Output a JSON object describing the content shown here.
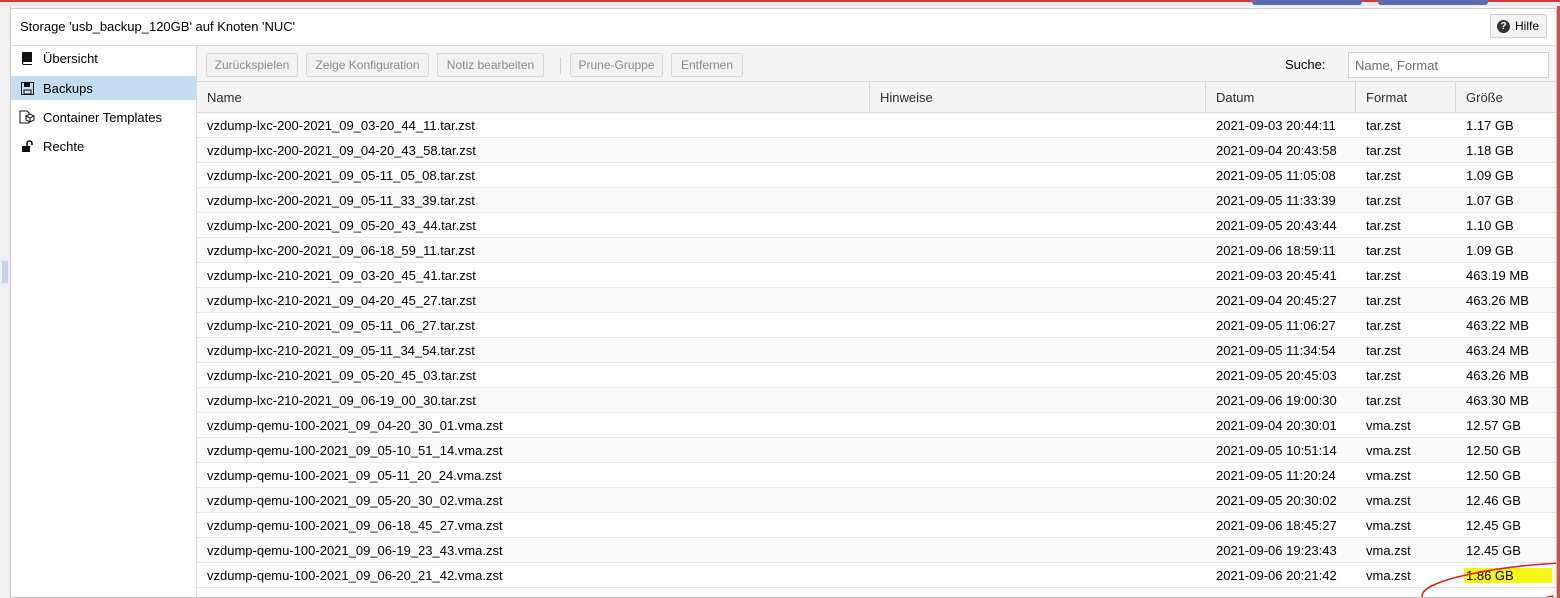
{
  "window": {
    "title": "Storage 'usb_backup_120GB' auf Knoten 'NUC'",
    "help_label": "Hilfe"
  },
  "sidebar": {
    "items": [
      {
        "label": "Übersicht",
        "icon": "book-icon"
      },
      {
        "label": "Backups",
        "icon": "floppy-disk-icon"
      },
      {
        "label": "Container Templates",
        "icon": "container-template-icon"
      },
      {
        "label": "Rechte",
        "icon": "unlock-icon"
      }
    ],
    "active": "Backups"
  },
  "toolbar": {
    "restore_label": "Zurückspielen",
    "show_config_label": "Zeige Konfiguration",
    "edit_notes_label": "Notiz bearbeiten",
    "prune_group_label": "Prune-Gruppe",
    "remove_label": "Entfernen",
    "search_label": "Suche:",
    "search_placeholder": "Name, Format"
  },
  "table": {
    "headers": {
      "name": "Name",
      "notes": "Hinweise",
      "date": "Datum",
      "format": "Format",
      "size": "Größe"
    },
    "rows": [
      {
        "name": "vzdump-lxc-200-2021_09_03-20_44_11.tar.zst",
        "notes": "",
        "date": "2021-09-03 20:44:11",
        "format": "tar.zst",
        "size": "1.17 GB"
      },
      {
        "name": "vzdump-lxc-200-2021_09_04-20_43_58.tar.zst",
        "notes": "",
        "date": "2021-09-04 20:43:58",
        "format": "tar.zst",
        "size": "1.18 GB"
      },
      {
        "name": "vzdump-lxc-200-2021_09_05-11_05_08.tar.zst",
        "notes": "",
        "date": "2021-09-05 11:05:08",
        "format": "tar.zst",
        "size": "1.09 GB"
      },
      {
        "name": "vzdump-lxc-200-2021_09_05-11_33_39.tar.zst",
        "notes": "",
        "date": "2021-09-05 11:33:39",
        "format": "tar.zst",
        "size": "1.07 GB"
      },
      {
        "name": "vzdump-lxc-200-2021_09_05-20_43_44.tar.zst",
        "notes": "",
        "date": "2021-09-05 20:43:44",
        "format": "tar.zst",
        "size": "1.10 GB"
      },
      {
        "name": "vzdump-lxc-200-2021_09_06-18_59_11.tar.zst",
        "notes": "",
        "date": "2021-09-06 18:59:11",
        "format": "tar.zst",
        "size": "1.09 GB"
      },
      {
        "name": "vzdump-lxc-210-2021_09_03-20_45_41.tar.zst",
        "notes": "",
        "date": "2021-09-03 20:45:41",
        "format": "tar.zst",
        "size": "463.19 MB"
      },
      {
        "name": "vzdump-lxc-210-2021_09_04-20_45_27.tar.zst",
        "notes": "",
        "date": "2021-09-04 20:45:27",
        "format": "tar.zst",
        "size": "463.26 MB"
      },
      {
        "name": "vzdump-lxc-210-2021_09_05-11_06_27.tar.zst",
        "notes": "",
        "date": "2021-09-05 11:06:27",
        "format": "tar.zst",
        "size": "463.22 MB"
      },
      {
        "name": "vzdump-lxc-210-2021_09_05-11_34_54.tar.zst",
        "notes": "",
        "date": "2021-09-05 11:34:54",
        "format": "tar.zst",
        "size": "463.24 MB"
      },
      {
        "name": "vzdump-lxc-210-2021_09_05-20_45_03.tar.zst",
        "notes": "",
        "date": "2021-09-05 20:45:03",
        "format": "tar.zst",
        "size": "463.26 MB"
      },
      {
        "name": "vzdump-lxc-210-2021_09_06-19_00_30.tar.zst",
        "notes": "",
        "date": "2021-09-06 19:00:30",
        "format": "tar.zst",
        "size": "463.30 MB"
      },
      {
        "name": "vzdump-qemu-100-2021_09_04-20_30_01.vma.zst",
        "notes": "",
        "date": "2021-09-04 20:30:01",
        "format": "vma.zst",
        "size": "12.57 GB"
      },
      {
        "name": "vzdump-qemu-100-2021_09_05-10_51_14.vma.zst",
        "notes": "",
        "date": "2021-09-05 10:51:14",
        "format": "vma.zst",
        "size": "12.50 GB"
      },
      {
        "name": "vzdump-qemu-100-2021_09_05-11_20_24.vma.zst",
        "notes": "",
        "date": "2021-09-05 11:20:24",
        "format": "vma.zst",
        "size": "12.50 GB"
      },
      {
        "name": "vzdump-qemu-100-2021_09_05-20_30_02.vma.zst",
        "notes": "",
        "date": "2021-09-05 20:30:02",
        "format": "vma.zst",
        "size": "12.46 GB"
      },
      {
        "name": "vzdump-qemu-100-2021_09_06-18_45_27.vma.zst",
        "notes": "",
        "date": "2021-09-06 18:45:27",
        "format": "vma.zst",
        "size": "12.45 GB"
      },
      {
        "name": "vzdump-qemu-100-2021_09_06-19_23_43.vma.zst",
        "notes": "",
        "date": "2021-09-06 19:23:43",
        "format": "vma.zst",
        "size": "12.45 GB"
      },
      {
        "name": "vzdump-qemu-100-2021_09_06-20_21_42.vma.zst",
        "notes": "",
        "date": "2021-09-06 20:21:42",
        "format": "vma.zst",
        "size": "1.86 GB",
        "highlighted": true
      }
    ]
  },
  "colors": {
    "active_nav": "#c5ddf2",
    "highlight": "#f5f516",
    "annotation": "#e02020",
    "window_border": "#d23b3b"
  }
}
